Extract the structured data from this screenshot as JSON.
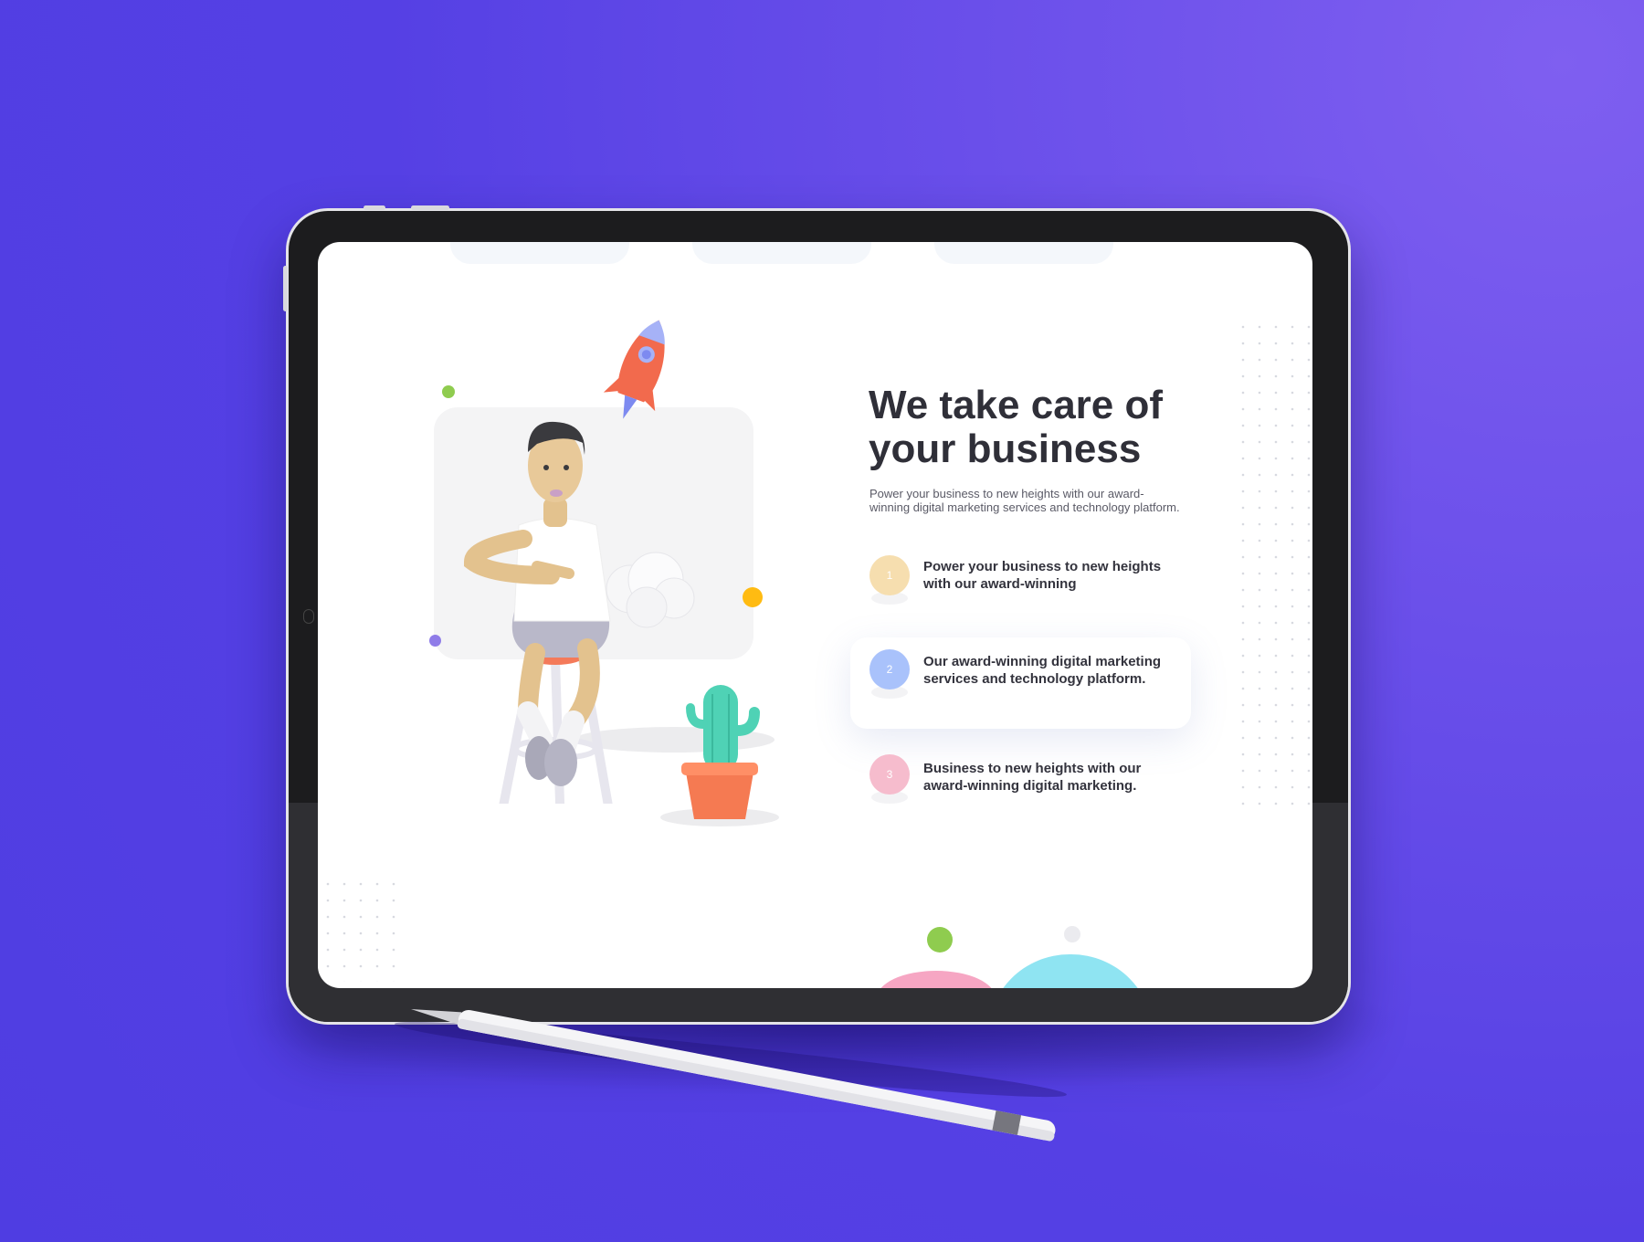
{
  "page": {
    "heading": "We take care of your business",
    "lead": "Power your business to new heights with our award-winning digital marketing services and technology platform.",
    "features": [
      {
        "number": "1",
        "text": "Power your business to new heights with our award-winning",
        "accent": "#f6deaf"
      },
      {
        "number": "2",
        "text": "Our award-winning digital marketing services and technology platform.",
        "accent": "#a9c2fb",
        "active": true
      },
      {
        "number": "3",
        "text": "Business to new heights with our award-winning digital marketing.",
        "accent": "#f6bccd"
      }
    ]
  },
  "colors": {
    "background": "#5540e4",
    "heading": "#2f2f38",
    "rocket": "#f26a4d",
    "cactus": "#4fd2b5",
    "pot": "#f57a52"
  },
  "icons": [
    "rocket-icon",
    "cloud-icon",
    "cactus-icon",
    "stylus-icon"
  ]
}
